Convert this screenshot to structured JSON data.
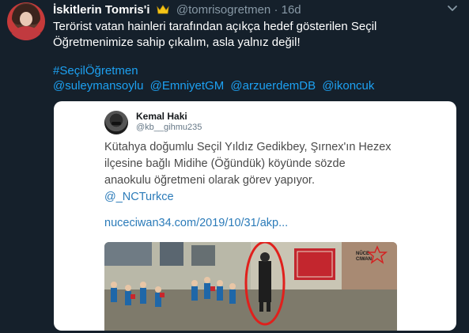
{
  "tweet": {
    "display_name": "İskitlerin Tomris'i",
    "handle": "@tomrisogretmen",
    "separator": "·",
    "age": "16d",
    "text_line1": "Terörist vatan hainleri tarafından açıkça hedef gösterilen Seçil",
    "text_line2": "Öğretmenimize sahip çıkalım, asla yalnız değil!",
    "hashtag": "#SeçilÖğretmen",
    "mentions": [
      "@suleymansoylu",
      "@EmniyetGM",
      "@arzuerdemDB",
      "@ikoncuk"
    ],
    "crown_icon": "crown-icon",
    "more_icon": "chevron-down-icon"
  },
  "quote": {
    "name": "Kemal Haki",
    "handle": "@kb__gihmu235",
    "line1": "Kütahya doğumlu Seçil Yıldız Gedikbey, Şırnex'ın Hezex",
    "line2": "ilçesine bağlı Midihe (Öğündük) köyünde sözde",
    "line3": "anaokulu öğretmeni olarak görev yapıyor.",
    "mention": "@_NCTurkce",
    "url": "nuceciwan34.com/2019/10/31/akp...",
    "banner_text": "NÛCE CIWAN"
  },
  "colors": {
    "background": "#15202b",
    "link": "#1da1f2",
    "secondary": "#8899a6",
    "highlight_circle": "#e0201c"
  }
}
